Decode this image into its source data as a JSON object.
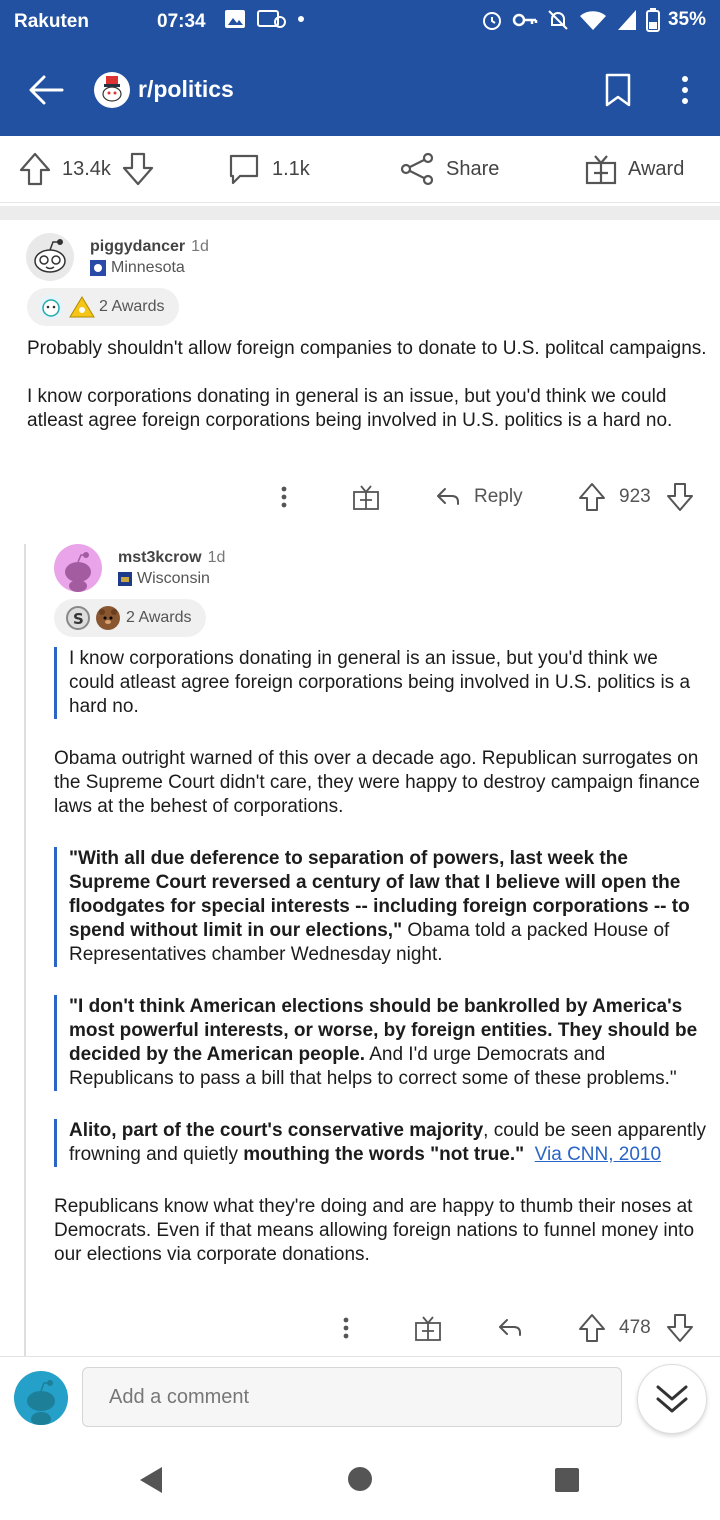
{
  "status_bar": {
    "carrier": "Rakuten",
    "time": "07:34",
    "battery": "35%"
  },
  "app_bar": {
    "subreddit": "r/politics"
  },
  "post_actions": {
    "upvotes": "13.4k",
    "comments": "1.1k",
    "share": "Share",
    "award": "Award"
  },
  "comments": [
    {
      "username": "piggydancer",
      "age": "1d",
      "flair": "Minnesota",
      "awards": "2 Awards",
      "paragraphs": [
        "Probably shouldn't allow foreign companies to donate to U.S. politcal campaigns.",
        "I know corporations donating in general is an issue, but you'd think we could atleast agree foreign corporations being involved in U.S. politics is a hard no."
      ],
      "reply_label": "Reply",
      "score": "923"
    },
    {
      "username": "mst3kcrow",
      "age": "1d",
      "flair": "Wisconsin",
      "awards": "2 Awards",
      "quote1": "I know corporations donating in general is an issue, but you'd think we could atleast agree foreign corporations being involved in U.S. politics is a hard no.",
      "para1": "Obama outright warned of this over a decade ago.  Republican surrogates on the Supreme Court didn't care, they were happy to destroy campaign finance laws at the behest of corporations.",
      "quote2_bold": "\"With all due deference to separation of powers, last week the Supreme Court reversed a century of law that I believe will open the floodgates for special interests -- including foreign corporations -- to spend without limit in our elections,\"",
      "quote2_rest": " Obama told a packed House of Representatives chamber Wednesday night.",
      "quote3_bold": "\"I don't think American elections should be bankrolled by America's most powerful interests, or worse, by foreign entities. They should be decided by the American people.",
      "quote3_rest": " And I'd urge Democrats and Republicans to pass a bill that helps to correct some of these problems.\"",
      "quote4_bold1": "Alito, part of the court's conservative majority",
      "quote4_mid": ", could be seen apparently frowning and quietly ",
      "quote4_bold2": "mouthing the words \"not true.\"",
      "quote4_link": "Via CNN, 2010",
      "para2": "Republicans know what they're doing and are happy to thumb their noses at Democrats.  Even if that means allowing foreign nations to funnel money into our elections via corporate donations.",
      "score": "478"
    }
  ],
  "composer": {
    "placeholder": "Add a comment"
  },
  "colors": {
    "brand_blue": "#2151a0",
    "link_blue": "#2a64c5"
  }
}
